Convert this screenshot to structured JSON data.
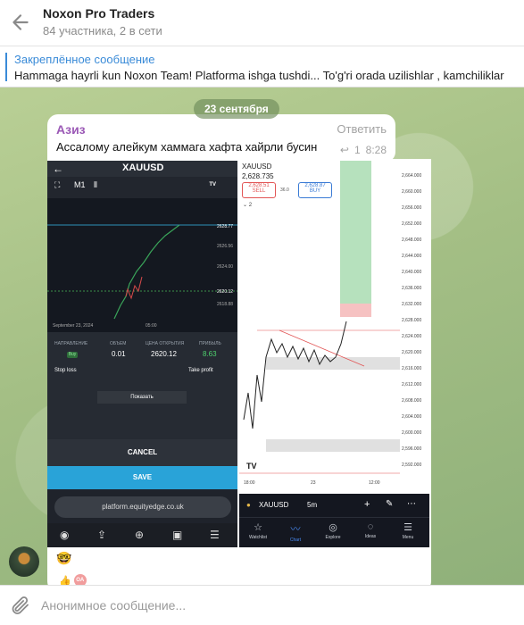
{
  "header": {
    "title": "Noxon Pro Traders",
    "subtitle": "84 участника, 2 в сети"
  },
  "pinned": {
    "title": "Закреплённое сообщение",
    "text": "Hammaga hayrli kun Noxon Team!  Platforma ishga tushdi... To'g'ri orada uzilishlar , kamchiliklar"
  },
  "date_divider": "23 сентября",
  "message": {
    "sender": "Азиз",
    "reply_label": "Ответить",
    "text": "Ассалому алейкум хаммага хафта хайрли бусин",
    "replies_count": "1",
    "time": "8:28"
  },
  "screenshot_left": {
    "symbol": "XAUUSD",
    "timeframe": "M1",
    "prices": [
      "2628.77",
      "2626.56",
      "2624.00",
      "2620.12",
      "2618.88"
    ],
    "date_label": "September 23, 2024",
    "time_label": "05:00",
    "direction_label": "НАПРАВЛЕНИЕ",
    "direction_value": "Buy",
    "volume_label": "ОБЪЕМ",
    "volume_value": "0.01",
    "open_price_label": "ЦЕНА ОТКРЫТИЯ",
    "open_price_value": "2620.12",
    "profit_label": "ПРИБЫЛЬ",
    "profit_value": "8.63",
    "stop_loss": "Stop loss",
    "take_profit": "Take profit",
    "show_button": "Показать",
    "cancel": "CANCEL",
    "save": "SAVE",
    "url": "platform.equityedge.co.uk"
  },
  "screenshot_right": {
    "symbol": "XAUUSD",
    "last_price": "2,628.735",
    "sell_price": "2,628.51",
    "sell_label": "SELL",
    "buy_price": "2,628.87",
    "buy_label": "BUY",
    "spread": "36.0",
    "indicator_count": "2",
    "axis": [
      "2,664.000",
      "2,660.000",
      "2,656.000",
      "2,652.000",
      "2,648.000",
      "2,644.000",
      "2,640.000",
      "2,636.000",
      "2,632.000",
      "2,628.000",
      "2,624.000",
      "2,620.000",
      "2,616.000",
      "2,612.000",
      "2,608.000",
      "2,604.000",
      "2,600.000",
      "2,596.000",
      "2,592.000"
    ],
    "time_axis": [
      "18:00",
      "23",
      "12:00"
    ],
    "bottom_symbol": "XAUUSD",
    "bottom_tf": "5m",
    "nav": [
      "Watchlist",
      "Chart",
      "Explore",
      "Ideas",
      "Menu"
    ]
  },
  "reaction_initials": "OA",
  "input": {
    "placeholder": "Анонимное сообщение..."
  }
}
